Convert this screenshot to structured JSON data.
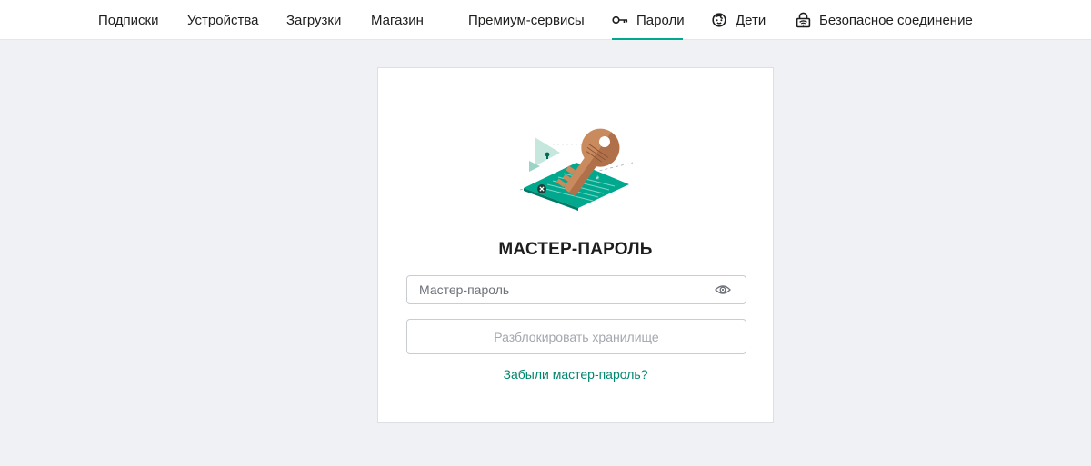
{
  "nav": {
    "items": [
      {
        "label": "Подписки"
      },
      {
        "label": "Устройства"
      },
      {
        "label": "Загрузки"
      },
      {
        "label": "Магазин"
      },
      {
        "label": "Премиум-сервисы"
      },
      {
        "label": "Пароли",
        "icon": "key-icon",
        "active": true
      },
      {
        "label": "Дети",
        "icon": "child-face-icon"
      },
      {
        "label": "Безопасное соединение",
        "icon": "secure-connection-icon"
      }
    ]
  },
  "unlock": {
    "illustration": "key-illustration",
    "title": "МАСТЕР-ПАРОЛЬ",
    "password_placeholder": "Мастер-пароль",
    "password_value": "",
    "eye_icon": "eye-icon",
    "unlock_button_label": "Разблокировать хранилище",
    "forgot_link": "Забыли мастер-пароль?"
  },
  "colors": {
    "accent": "#00a88e",
    "link": "#00866e",
    "page_bg": "#f0f1f5",
    "key": "#c98a5e"
  }
}
